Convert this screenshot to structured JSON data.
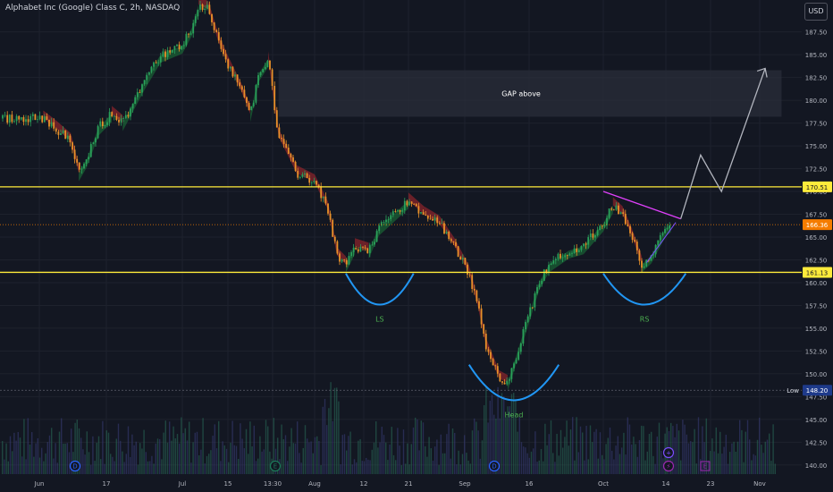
{
  "header": {
    "title": "Alphabet Inc (Google) Class C, 2h, NASDAQ",
    "currency": "USD"
  },
  "colors": {
    "background": "#131722",
    "up": "#2aa05a",
    "down": "#e8912a",
    "level": "#ffeb3b",
    "price": "#f57c00",
    "arc": "#2196f3",
    "trend": "#e040fb",
    "projection": "#b2b5be",
    "low": "#1e3a8a"
  },
  "chart_data": {
    "type": "candlestick",
    "y_axis": {
      "ylim": [
        139.0,
        191.0
      ],
      "ticks": [
        140.0,
        142.5,
        145.0,
        147.5,
        150.0,
        152.5,
        155.0,
        157.5,
        160.0,
        162.5,
        165.0,
        167.5,
        170.0,
        172.5,
        175.0,
        177.5,
        180.0,
        182.5,
        185.0,
        187.5
      ]
    },
    "x_axis": {
      "ticks": [
        "Jun",
        "17",
        "Jul",
        "15",
        "13:30",
        "Aug",
        "12",
        "21",
        "Sep",
        "16",
        "Oct",
        "14",
        "23",
        "Nov"
      ]
    },
    "price_path": [
      [
        "Jun 1",
        178.0
      ],
      [
        "Jun 4",
        177.0
      ],
      [
        "Jun 8",
        175.5
      ],
      [
        "Jun 10",
        172.0
      ],
      [
        "Jun 12",
        173.5
      ],
      [
        "Jun 15",
        177.0
      ],
      [
        "Jun 18",
        178.5
      ],
      [
        "Jun 20",
        177.5
      ],
      [
        "Jun 24",
        182.0
      ],
      [
        "Jun 27",
        185.0
      ],
      [
        "Jul 1",
        186.0
      ],
      [
        "Jul 4",
        188.0
      ],
      [
        "Jul 6",
        190.5
      ],
      [
        "Jul 9",
        190.0
      ],
      [
        "Jul 12",
        186.5
      ],
      [
        "Jul 15",
        184.0
      ],
      [
        "Jul 18",
        181.0
      ],
      [
        "Jul 20",
        178.5
      ],
      [
        "Jul 22",
        183.0
      ],
      [
        "Jul 24",
        184.5
      ],
      [
        "Jul 25",
        181.0
      ],
      [
        "Jul 26",
        176.0
      ],
      [
        "Jul 29",
        172.0
      ],
      [
        "Aug 1",
        171.0
      ],
      [
        "Aug 4",
        168.0
      ],
      [
        "Aug 6",
        163.0
      ],
      [
        "Aug 8",
        162.0
      ],
      [
        "Aug 10",
        164.0
      ],
      [
        "Aug 13",
        163.5
      ],
      [
        "Aug 15",
        166.0
      ],
      [
        "Aug 19",
        168.0
      ],
      [
        "Aug 21",
        169.0
      ],
      [
        "Aug 24",
        167.5
      ],
      [
        "Aug 27",
        166.5
      ],
      [
        "Aug 30",
        164.0
      ],
      [
        "Sep 2",
        161.0
      ],
      [
        "Sep 4",
        157.5
      ],
      [
        "Sep 6",
        153.0
      ],
      [
        "Sep 9",
        149.5
      ],
      [
        "Sep 11",
        149.0
      ],
      [
        "Sep 13",
        152.0
      ],
      [
        "Sep 16",
        156.5
      ],
      [
        "Sep 18",
        160.0
      ],
      [
        "Sep 20",
        162.0
      ],
      [
        "Sep 24",
        163.5
      ],
      [
        "Sep 27",
        164.0
      ],
      [
        "Oct 1",
        166.5
      ],
      [
        "Oct 3",
        168.5
      ],
      [
        "Oct 5",
        167.5
      ],
      [
        "Oct 7",
        165.0
      ],
      [
        "Oct 9",
        162.0
      ],
      [
        "Oct 11",
        163.0
      ],
      [
        "Oct 14",
        166.0
      ],
      [
        "Oct 15",
        166.4
      ]
    ],
    "horizontal_levels": [
      {
        "label": "170.51",
        "value": 170.51
      },
      {
        "label": "161.13",
        "value": 161.13
      }
    ],
    "current_price": {
      "label": "166.36",
      "value": 166.36
    },
    "low_marker": {
      "name": "Low",
      "label": "148.20",
      "value": 148.2
    },
    "gap_zone": {
      "label": "GAP above",
      "from_date": "Jul 26",
      "to_date": "Nov 5",
      "low": 178.2,
      "high": 183.3
    },
    "pattern_arcs": [
      {
        "label": "LS",
        "from_date": "Aug 8",
        "to_date": "Aug 22",
        "top": 161.0,
        "bottom": 157.5
      },
      {
        "label": "Head",
        "from_date": "Sep 2",
        "to_date": "Sep 22",
        "top": 151.0,
        "bottom": 147.0
      },
      {
        "label": "RS",
        "from_date": "Oct 1",
        "to_date": "Oct 18",
        "top": 161.0,
        "bottom": 157.5
      }
    ],
    "trendline": [
      [
        "Oct 1",
        170.0
      ],
      [
        "Oct 17",
        167.0
      ]
    ],
    "projection_path": [
      [
        "Oct 17",
        167.0
      ],
      [
        "Oct 21",
        174.0
      ],
      [
        "Oct 25",
        170.0
      ],
      [
        "Nov 2",
        183.5
      ]
    ],
    "event_markers": [
      "D",
      "E",
      "D",
      "+",
      "⚡",
      "E"
    ]
  }
}
